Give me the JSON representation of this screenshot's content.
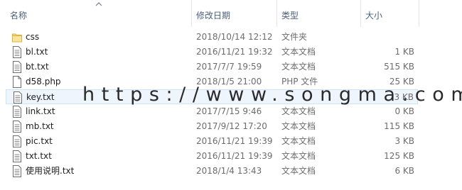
{
  "columns": {
    "name": "名称",
    "date": "修改日期",
    "type": "类型",
    "size": "大小"
  },
  "files": [
    {
      "name": "css",
      "date": "2018/10/14 12:12",
      "type": "文件夹",
      "size": "",
      "icon": "folder-icon"
    },
    {
      "name": "bl.txt",
      "date": "2016/11/21 19:32",
      "type": "文本文档",
      "size": "1 KB",
      "icon": "text-file-icon"
    },
    {
      "name": "bt.txt",
      "date": "2017/7/7 19:59",
      "type": "文本文档",
      "size": "515 KB",
      "icon": "text-file-icon"
    },
    {
      "name": "d58.php",
      "date": "2018/1/5 21:00",
      "type": "PHP 文件",
      "size": "25 KB",
      "icon": "php-file-icon"
    },
    {
      "name": "key.txt",
      "date": "",
      "type": "",
      "size": "3 KB",
      "icon": "text-file-icon"
    },
    {
      "name": "link.txt",
      "date": "2017/7/15 9:46",
      "type": "文本文档",
      "size": "0 KB",
      "icon": "text-file-icon"
    },
    {
      "name": "mb.txt",
      "date": "2017/9/12 17:20",
      "type": "文本文档",
      "size": "115 KB",
      "icon": "text-file-icon"
    },
    {
      "name": "pic.txt",
      "date": "2016/11/21 19:39",
      "type": "文本文档",
      "size": "3 KB",
      "icon": "text-file-icon"
    },
    {
      "name": "txt.txt",
      "date": "2016/11/21 19:39",
      "type": "文本文档",
      "size": "125 KB",
      "icon": "text-file-icon"
    },
    {
      "name": "使用说明.txt",
      "date": "2018/1/4 13:43",
      "type": "文本文档",
      "size": "6 KB",
      "icon": "text-file-icon"
    }
  ],
  "watermark": "https://www.songma.com"
}
